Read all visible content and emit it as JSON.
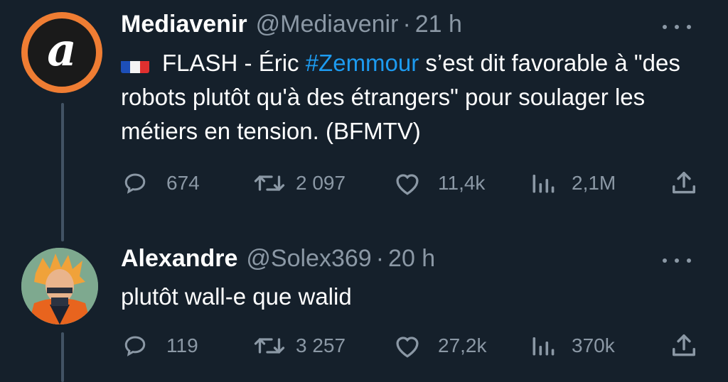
{
  "tweets": [
    {
      "display_name": "Mediavenir",
      "handle": "@Mediavenir",
      "separator": "·",
      "time": "21 h",
      "flag_emoji": "🇫🇷",
      "text_before": "FLASH - Éric ",
      "hashtag": "#Zemmour",
      "text_after": " s’est dit favorable à \"des robots plutôt qu'à des étrangers\" pour soulager les métiers en tension. (BFMTV)",
      "avatar_letter": "a",
      "actions": {
        "replies": "674",
        "retweets": "2 097",
        "likes": "11,4k",
        "views": "2,1M"
      }
    },
    {
      "display_name": "Alexandre",
      "handle": "@Solex369",
      "separator": "·",
      "time": "20 h",
      "text": "plutôt wall-e que walid",
      "actions": {
        "replies": "119",
        "retweets": "3 257",
        "likes": "27,2k",
        "views": "370k"
      }
    }
  ],
  "icons": {
    "reply": "reply-icon",
    "retweet": "retweet-icon",
    "like": "heart-icon",
    "views": "analytics-icon",
    "share": "share-icon",
    "more": "more-icon"
  },
  "colors": {
    "background": "#15202b",
    "secondary_text": "#8b98a5",
    "link": "#1d9bf0",
    "avatar_ring": "#ef7d33"
  }
}
